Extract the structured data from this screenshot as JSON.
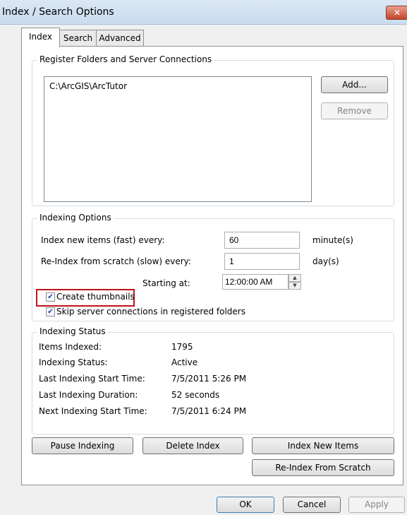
{
  "window": {
    "title": "Index / Search Options",
    "close_glyph": "✕"
  },
  "tabs": [
    {
      "label": "Index",
      "active": true
    },
    {
      "label": "Search",
      "active": false
    },
    {
      "label": "Advanced",
      "active": false
    }
  ],
  "register": {
    "group_label": "Register Folders and Server Connections",
    "items": [
      "C:\\ArcGIS\\ArcTutor"
    ],
    "add_label": "Add...",
    "remove_label": "Remove"
  },
  "indexing_options": {
    "group_label": "Indexing Options",
    "fast_label": "Index new items (fast) every:",
    "fast_value": "60",
    "fast_unit": "minute(s)",
    "slow_label": "Re-Index from scratch (slow) every:",
    "slow_value": "1",
    "slow_unit": "day(s)",
    "start_label": "Starting at:",
    "start_value": "12:00:00 AM",
    "create_thumbnails_label": "Create thumbnails",
    "create_thumbnails_checked": true,
    "skip_server_label": "Skip server connections in registered folders",
    "skip_server_checked": true
  },
  "status": {
    "group_label": "Indexing Status",
    "rows": [
      {
        "label": "Items Indexed:",
        "value": "1795"
      },
      {
        "label": "Indexing Status:",
        "value": "Active"
      },
      {
        "label": "Last Indexing Start Time:",
        "value": "7/5/2011 5:26 PM"
      },
      {
        "label": "Last Indexing Duration:",
        "value": "52 seconds"
      },
      {
        "label": "Next Indexing Start Time:",
        "value": "7/5/2011 6:24 PM"
      }
    ]
  },
  "actions": {
    "pause_label": "Pause Indexing",
    "delete_label": "Delete Index",
    "index_new_label": "Index New Items",
    "reindex_label": "Re-Index From Scratch"
  },
  "footer": {
    "ok_label": "OK",
    "cancel_label": "Cancel",
    "apply_label": "Apply"
  },
  "colors": {
    "highlight_border": "#c0141a",
    "checkmark": "#21409a"
  }
}
